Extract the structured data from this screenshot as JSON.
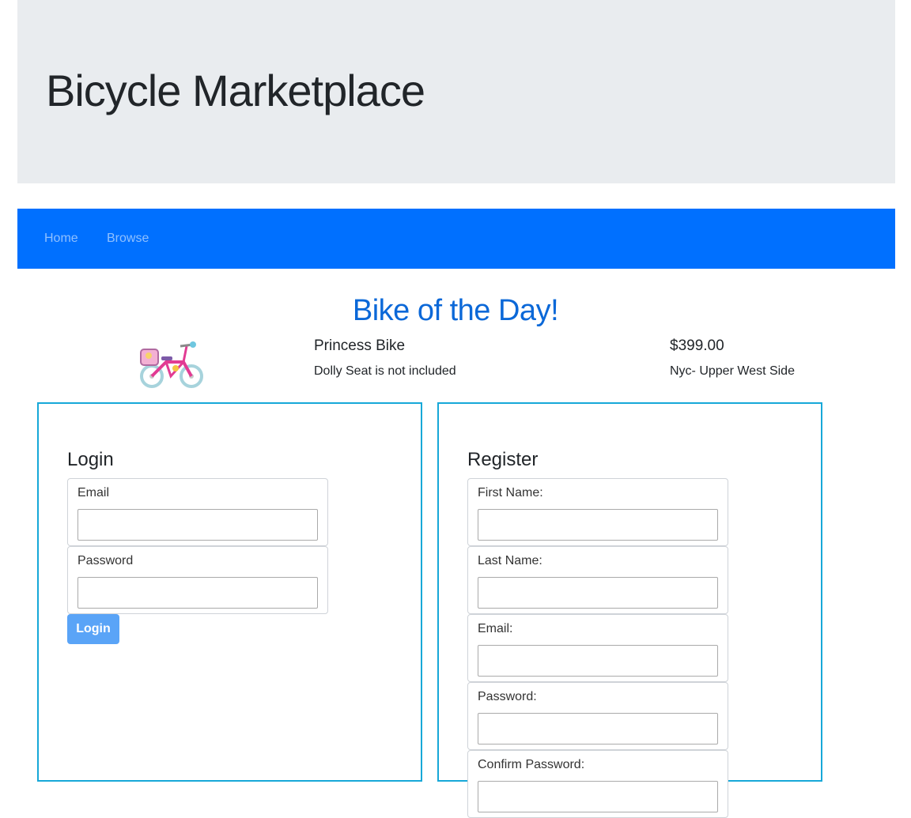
{
  "header": {
    "title": "Bicycle Marketplace"
  },
  "nav": {
    "items": [
      {
        "label": "Home"
      },
      {
        "label": "Browse"
      }
    ]
  },
  "featured": {
    "heading": "Bike of the Day!",
    "name": "Princess Bike",
    "description": "Dolly Seat is not included",
    "price": "$399.00",
    "location": "Nyc- Upper West Side"
  },
  "login": {
    "title": "Login",
    "email_label": "Email",
    "email_value": "",
    "password_label": "Password",
    "password_value": "",
    "button_label": "Login"
  },
  "register": {
    "title": "Register",
    "fields": [
      {
        "label": "First Name:",
        "value": ""
      },
      {
        "label": "Last Name:",
        "value": ""
      },
      {
        "label": "Email:",
        "value": ""
      },
      {
        "label": "Password:",
        "value": ""
      },
      {
        "label": "Confirm Password:",
        "value": ""
      }
    ]
  },
  "colors": {
    "navbar": "#0070ff",
    "jumbotron": "#e9ecef",
    "heading_blue": "#0b68d8",
    "panel_border": "#17a8d8",
    "button": "#5aa4f7"
  }
}
